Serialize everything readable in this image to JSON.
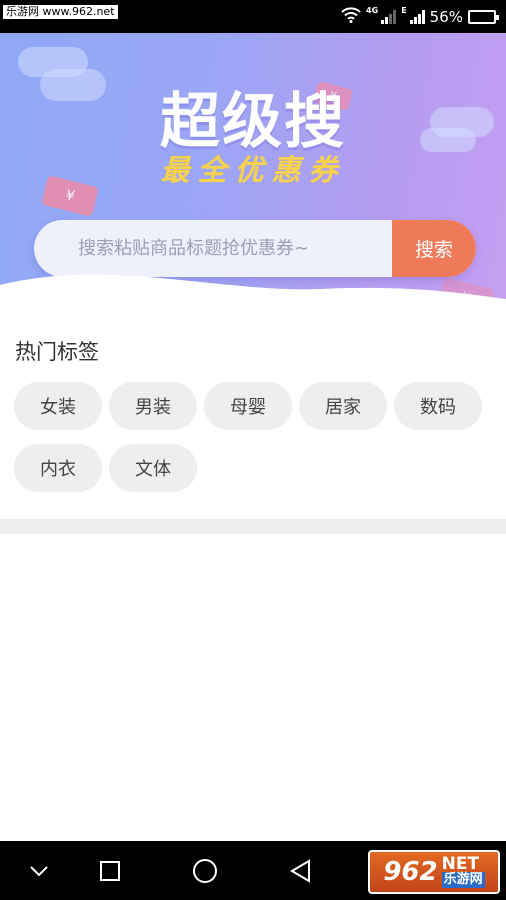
{
  "status_bar": {
    "watermark": "乐游网 www.962.net",
    "network_1": "4G",
    "network_2": "E",
    "battery_percent": "56%",
    "battery_level": 0.56,
    "icons": [
      "wifi-icon",
      "signal-icon",
      "battery-icon"
    ]
  },
  "hero": {
    "title": "超级搜",
    "subtitle": "最全优惠券",
    "ticket_symbol": "¥"
  },
  "search": {
    "placeholder": "搜索粘贴商品标题抢优惠券~",
    "button_label": "搜索"
  },
  "hot_tags": {
    "title": "热门标签",
    "items": [
      "女装",
      "男装",
      "母婴",
      "居家",
      "数码",
      "内衣",
      "文体"
    ]
  },
  "nav_bar": {
    "icons": [
      "chevron-down-icon",
      "recent-apps-icon",
      "home-icon",
      "back-icon"
    ],
    "logo_number": "962",
    "logo_net": "NET",
    "logo_cn": "乐游网"
  },
  "colors": {
    "accent": "#ef7a5a",
    "subtitle_yellow": "#f7d24a",
    "hero_start": "#8fa9f6",
    "hero_end": "#c6a0f2",
    "tag_bg": "#eeeeee"
  }
}
